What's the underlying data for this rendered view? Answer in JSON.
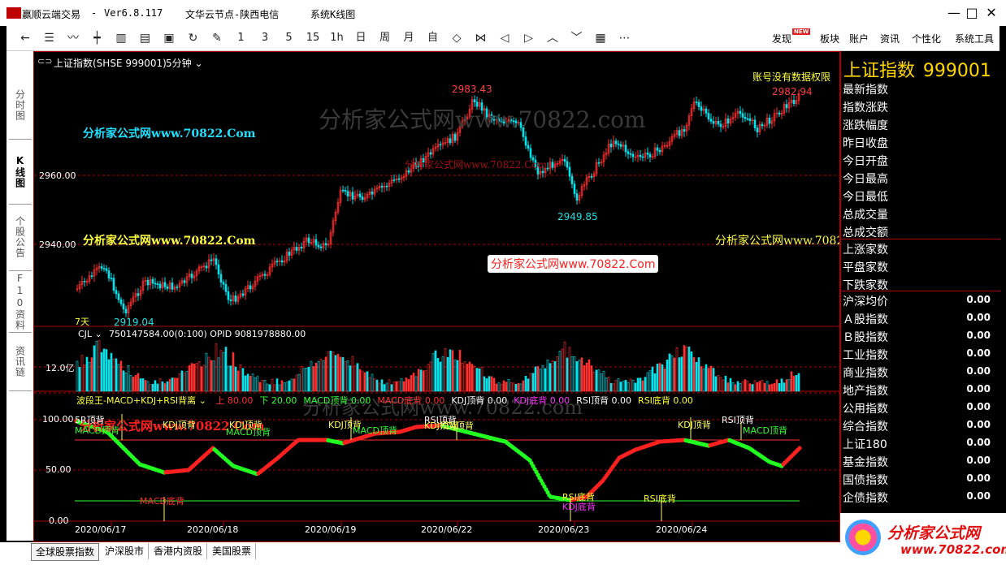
{
  "window": {
    "app_name": "赢顺云端交易",
    "version": "Ver6.8.117",
    "node": "文华云节点-陕西电信",
    "system_k": "系统K线图",
    "minimize": "—",
    "maximize": "□",
    "close": "✕"
  },
  "toolbar": {
    "icons": [
      "arrow-left-icon",
      "list-icon",
      "line-chart-icon",
      "candlestick-icon",
      "bar-chart-icon",
      "report-icon",
      "save-icon",
      "refresh-icon",
      "draw-tool-icon"
    ],
    "periods": [
      "1",
      "3",
      "5",
      "15",
      "1h",
      "日",
      "周",
      "月",
      "自"
    ],
    "nav_icons": [
      "zoom-out-icon",
      "zoom-in-icon",
      "scroll-left-icon",
      "scroll-right-icon",
      "expand-up-icon",
      "collapse-down-icon",
      "layout-icon",
      "more-icon"
    ],
    "right_items": [
      "发现",
      "板块",
      "账户",
      "资讯",
      "个性化",
      "系统工具"
    ],
    "new_badge": "NEW"
  },
  "left_tabs": [
    {
      "label": "分时图",
      "active": false
    },
    {
      "label": "K线图",
      "active": true
    },
    {
      "label": "个股公告",
      "active": false
    },
    {
      "label": "F10资料",
      "active": false
    },
    {
      "label": "资讯链",
      "active": false
    }
  ],
  "chart_header": {
    "symbol": "上证指数(SHSE 999001)",
    "period": "5分钟",
    "no_permission": "账号没有数据权限"
  },
  "price_axis": [
    "2960.00",
    "2940.00"
  ],
  "price_labels": {
    "high": "2983.43",
    "low_mid": "2949.85",
    "low": "2919.04",
    "last": "2982.94",
    "days": "7天"
  },
  "volume": {
    "header_name": "CJL",
    "header_values": "750147584.00(0:100)  OPID 9081978880.00",
    "axis_label": "12.0亿"
  },
  "indicator": {
    "header_name": "波段王-MACD+KDJ+RSI背离",
    "params": [
      {
        "text": "上 80.00",
        "color": "#ff3030"
      },
      {
        "text": "下 20.00",
        "color": "#30ff30"
      },
      {
        "text": "MACD顶背 0.00",
        "color": "#30ff30"
      },
      {
        "text": "MACD底背 0.00",
        "color": "#ff3030"
      },
      {
        "text": "KDJ顶背 0.00",
        "color": "#ffffff"
      },
      {
        "text": "KDJ底背 0.00",
        "color": "#ff30ff"
      },
      {
        "text": "RSI顶背 0.00",
        "color": "#ffffff"
      },
      {
        "text": "RSI底背 0.00",
        "color": "#ffff30"
      }
    ],
    "axis": [
      "100.00",
      "50.00",
      "0.00"
    ],
    "signals": [
      {
        "text": "5R顶背",
        "color": "#ffffff"
      },
      {
        "text": "MACD顶背",
        "color": "#30ff30"
      },
      {
        "text": "KDJ顶背",
        "color": "#ffff60"
      },
      {
        "text": "KDJ顶背",
        "color": "#ffff60"
      },
      {
        "text": "MACD顶背",
        "color": "#30ff30"
      },
      {
        "text": "KDJ顶背",
        "color": "#ffff60"
      },
      {
        "text": "MACD顶背",
        "color": "#30ff30"
      },
      {
        "text": "RSI顶背",
        "color": "#ffffff"
      },
      {
        "text": "KDJ顶背",
        "color": "#ffff60"
      },
      {
        "text": "KDJ顶背",
        "color": "#ffff60"
      },
      {
        "text": "RSI顶背",
        "color": "#ffffff"
      },
      {
        "text": "KDJ顶背",
        "color": "#ffff60"
      },
      {
        "text": "MACD顶背",
        "color": "#30ff30"
      },
      {
        "text": "MACD底背",
        "color": "#ff3030"
      },
      {
        "text": "RSI底背",
        "color": "#ffff30"
      },
      {
        "text": "KDJ底背",
        "color": "#ff30ff"
      },
      {
        "text": "RSI底背",
        "color": "#ffff30"
      }
    ]
  },
  "dates": [
    "2020/06/17",
    "2020/06/18",
    "2020/06/19",
    "2020/06/22",
    "2020/06/23",
    "2020/06/24"
  ],
  "watermarks": {
    "cn_cyan": "分析家公式网www.70822.Com",
    "cn_yellow": "分析家公式网www.70822.Com",
    "gray_big": "分析家公式网www.70822.com",
    "red_box": "分析家公式网www.70822.Com",
    "red_small": "分析家公式网www.70822.Com",
    "bottom_logo": "分析家公式网",
    "bottom_url": "www.70822.com"
  },
  "right_panel": {
    "title": "上证指数",
    "code": "999001",
    "top_labels": [
      "最新指数",
      "指数涨跌",
      "涨跌幅度",
      "昨日收盘",
      "今日开盘",
      "今日最高",
      "今日最低",
      "总成交量",
      "总成交额"
    ],
    "mid_labels": [
      "上涨家数",
      "平盘家数",
      "下跌家数"
    ],
    "rows": [
      {
        "label": "沪深均价",
        "value": "0.00"
      },
      {
        "label": "Ａ股指数",
        "value": "0.00"
      },
      {
        "label": "Ｂ股指数",
        "value": "0.00"
      },
      {
        "label": "工业指数",
        "value": "0.00"
      },
      {
        "label": "商业指数",
        "value": "0.00"
      },
      {
        "label": "地产指数",
        "value": "0.00"
      },
      {
        "label": "公用指数",
        "value": "0.00"
      },
      {
        "label": "综合指数",
        "value": "0.00"
      },
      {
        "label": "上证180",
        "value": "0.00"
      },
      {
        "label": "基金指数",
        "value": "0.00"
      },
      {
        "label": "国债指数",
        "value": "0.00"
      },
      {
        "label": "企债指数",
        "value": "0.00"
      }
    ]
  },
  "bottom_tabs": [
    "全球股票指数",
    "沪深股市",
    "香港内资股",
    "美国股票"
  ],
  "colors": {
    "up": "#ff3030",
    "down": "#00e5ee",
    "grid": "#b00000",
    "ind_up": "#ff2020",
    "ind_down": "#20ff20"
  }
}
